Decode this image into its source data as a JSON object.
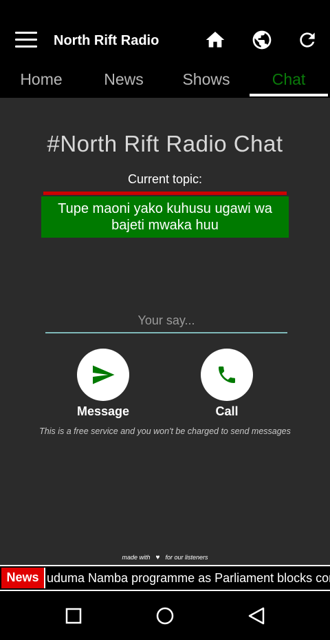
{
  "app": {
    "title": "North Rift Radio"
  },
  "tabs": [
    {
      "label": "Home",
      "active": false
    },
    {
      "label": "News",
      "active": false
    },
    {
      "label": "Shows",
      "active": false
    },
    {
      "label": "Chat",
      "active": true
    }
  ],
  "chat": {
    "title": "#North Rift Radio Chat",
    "topic_label": "Current topic:",
    "topic": "Tupe maoni yako kuhusu ugawi wa bajeti mwaka huu",
    "input_placeholder": "Your say...",
    "message_label": "Message",
    "call_label": "Call",
    "free_note": "This is a free service and you won't be charged to send messages"
  },
  "footer": {
    "made_with_left": "made with",
    "made_with_right": "for our listeners"
  },
  "ticker": {
    "badge": "News",
    "text": "uduma Namba programme as Parliament blocks cor"
  },
  "icons": {
    "menu": "hamburger-icon",
    "home": "home-icon",
    "globe": "globe-icon",
    "refresh": "refresh-icon",
    "send": "send-icon",
    "phone": "phone-icon"
  },
  "colors": {
    "accent_green": "#007a00",
    "tab_active": "#0a7a0a",
    "news_red": "#e00000",
    "topic_bar_red": "#cc0000",
    "content_bg": "#2b2b2b"
  }
}
